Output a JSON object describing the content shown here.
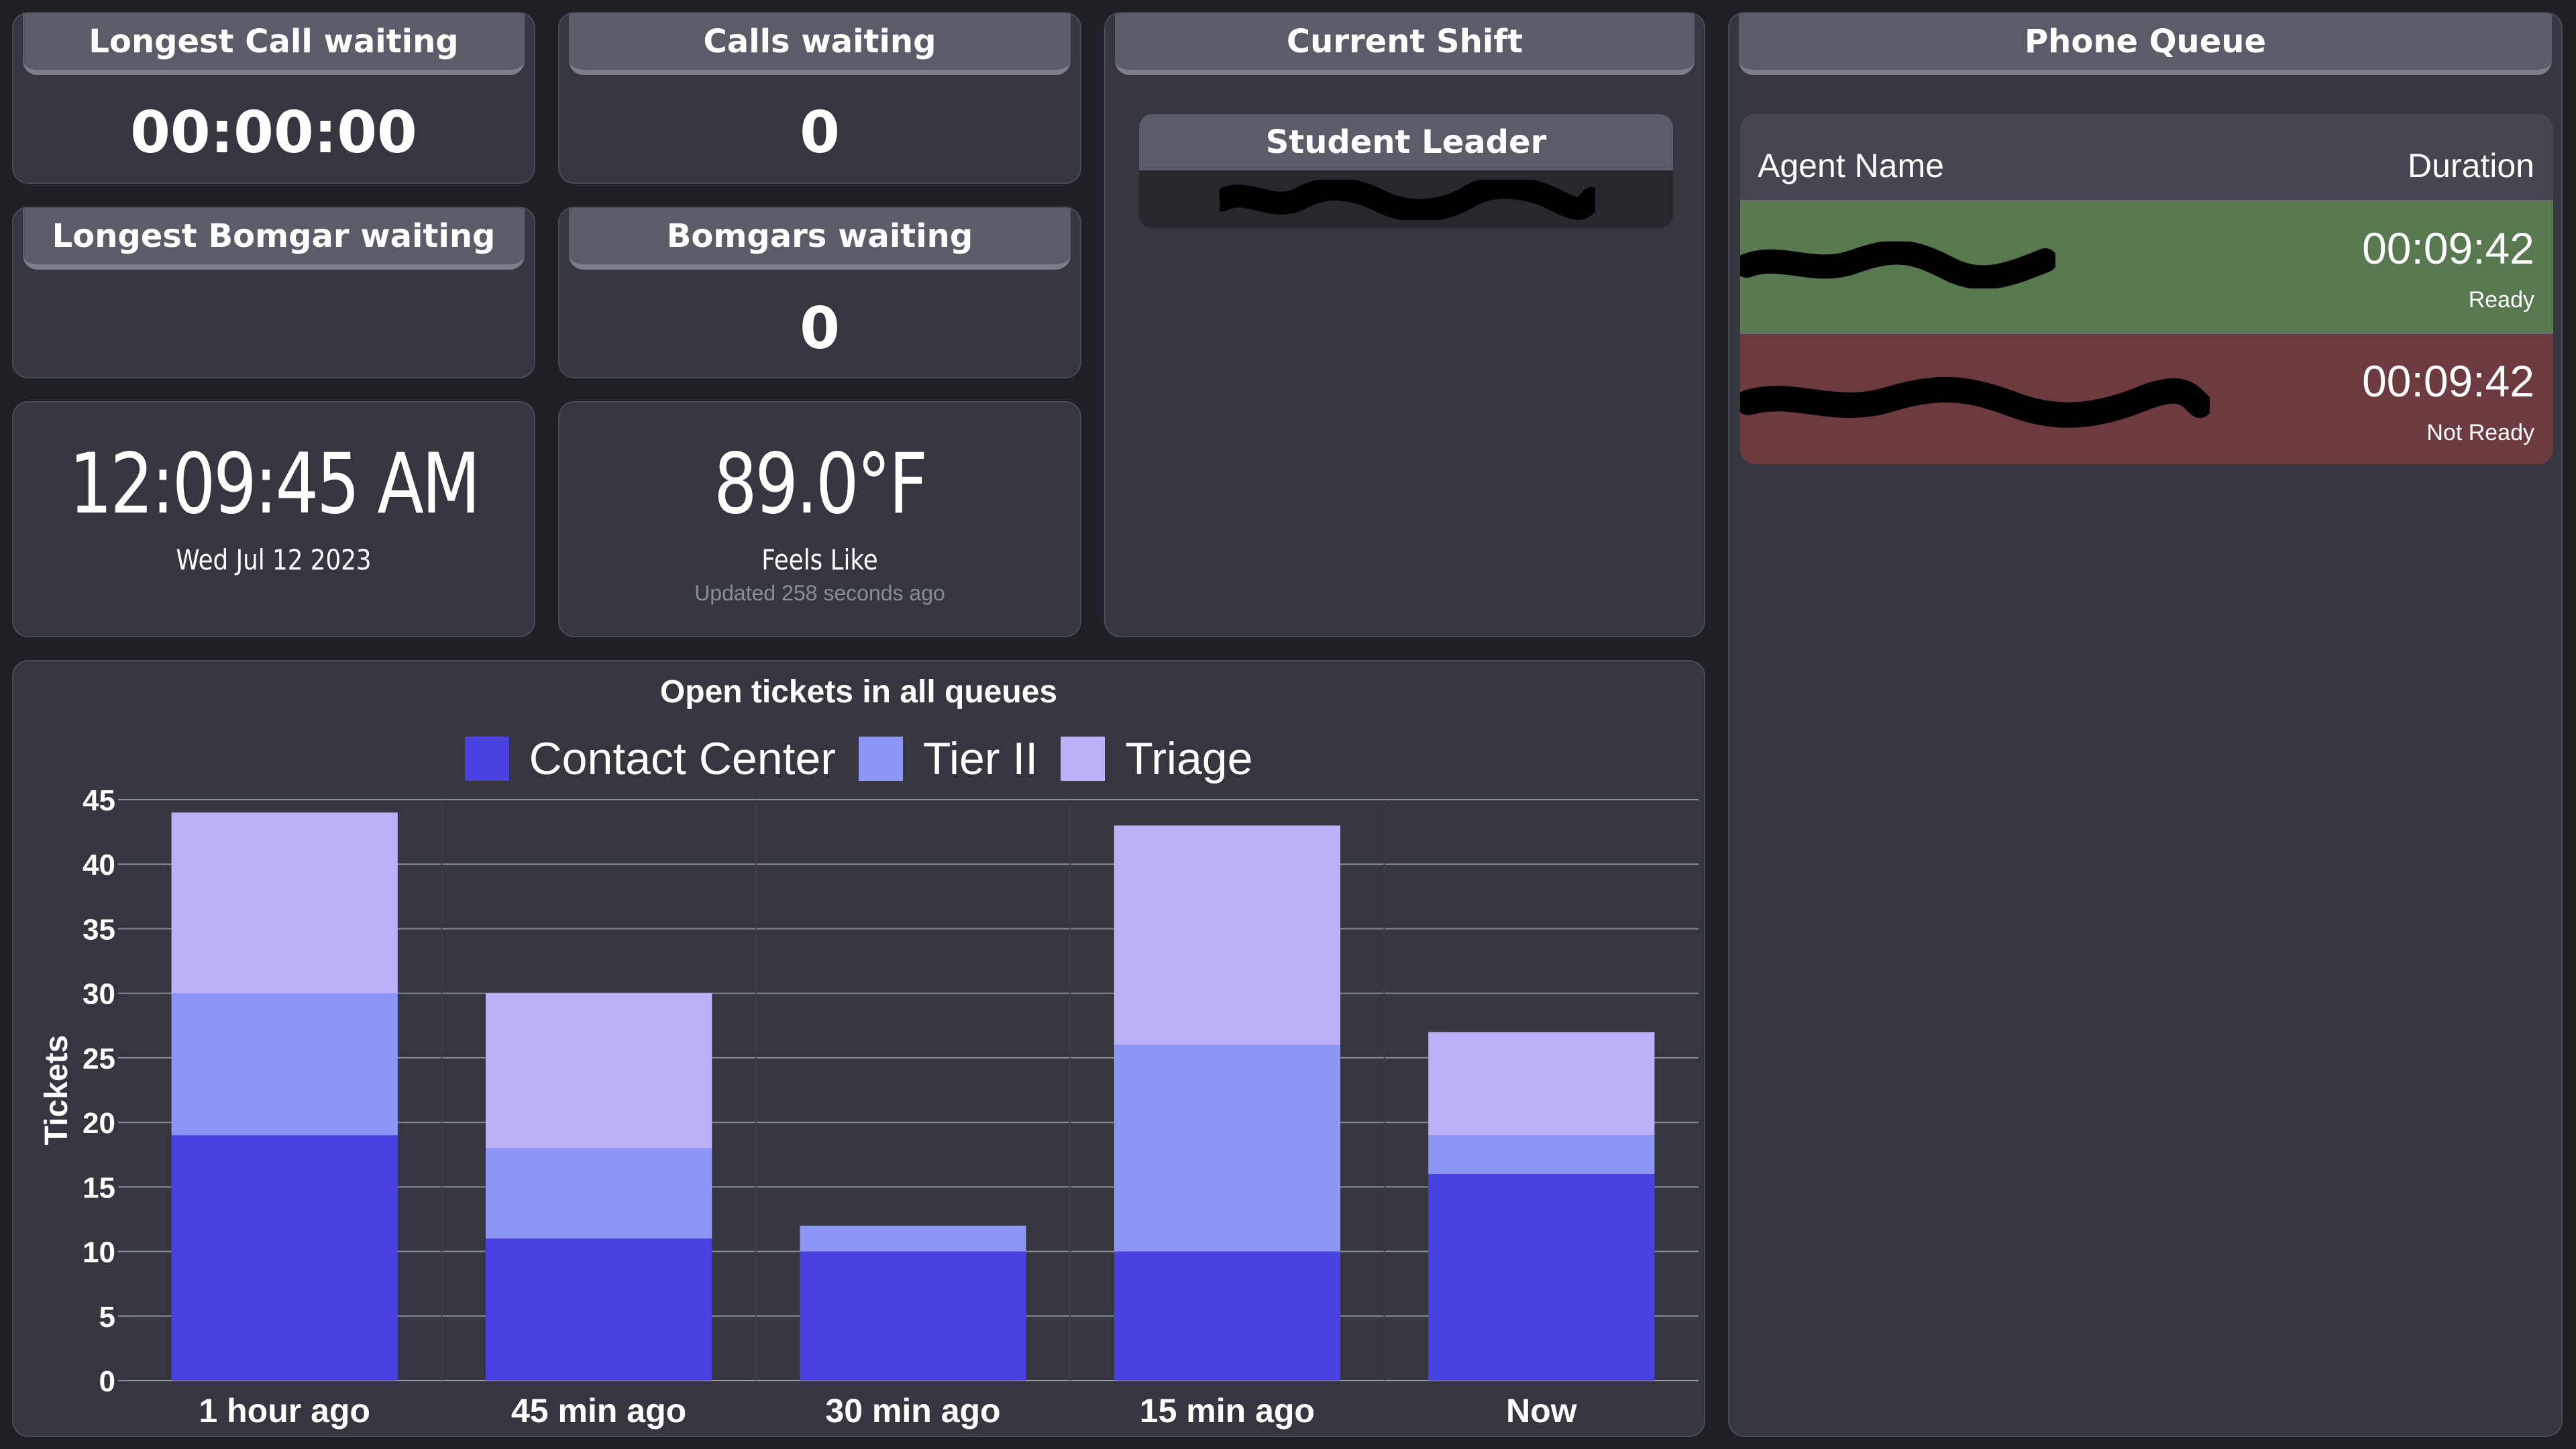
{
  "call_wait": {
    "title": "Longest Call waiting",
    "value": "00:00:00"
  },
  "calls_waiting": {
    "title": "Calls waiting",
    "value": "0"
  },
  "bomgar_wait": {
    "title": "Longest Bomgar waiting",
    "value": ""
  },
  "bomgars_waiting": {
    "title": "Bomgars waiting",
    "value": "0"
  },
  "clock": {
    "time": "12:09:45 AM",
    "date": "Wed Jul 12 2023"
  },
  "weather": {
    "temp": "89.0°F",
    "label": "Feels Like",
    "updated": "Updated 258 seconds ago"
  },
  "shift": {
    "title": "Current Shift",
    "leader_title": "Student Leader",
    "leader_name": "",
    "leader_name_note": "redacted"
  },
  "phone_queue": {
    "title": "Phone Queue",
    "col_name": "Agent Name",
    "col_duration": "Duration",
    "rows": [
      {
        "name": "",
        "duration": "00:09:42",
        "status": "Ready",
        "color": "#587850"
      },
      {
        "name": "",
        "duration": "00:09:42",
        "status": "Not Ready",
        "color": "#6d3a40"
      }
    ]
  },
  "chart_data": {
    "type": "bar",
    "stacked": true,
    "title": "Open tickets in all queues",
    "xlabel": "",
    "ylabel": "Tickets",
    "ylim": [
      0,
      45
    ],
    "yticks": [
      "0",
      "5",
      "10",
      "15",
      "20",
      "25",
      "30",
      "35",
      "40",
      "45"
    ],
    "categories": [
      "1 hour ago",
      "45 min ago",
      "30 min ago",
      "15 min ago",
      "Now"
    ],
    "series": [
      {
        "name": "Contact Center",
        "color": "#4a42e0",
        "values": [
          19,
          11,
          10,
          10,
          16
        ]
      },
      {
        "name": "Tier II",
        "color": "#8c96f5",
        "values": [
          11,
          7,
          2,
          16,
          3
        ]
      },
      {
        "name": "Triage",
        "color": "#bcb0f8",
        "values": [
          14,
          12,
          0,
          17,
          8
        ]
      }
    ],
    "grid": true,
    "legend": "top"
  }
}
